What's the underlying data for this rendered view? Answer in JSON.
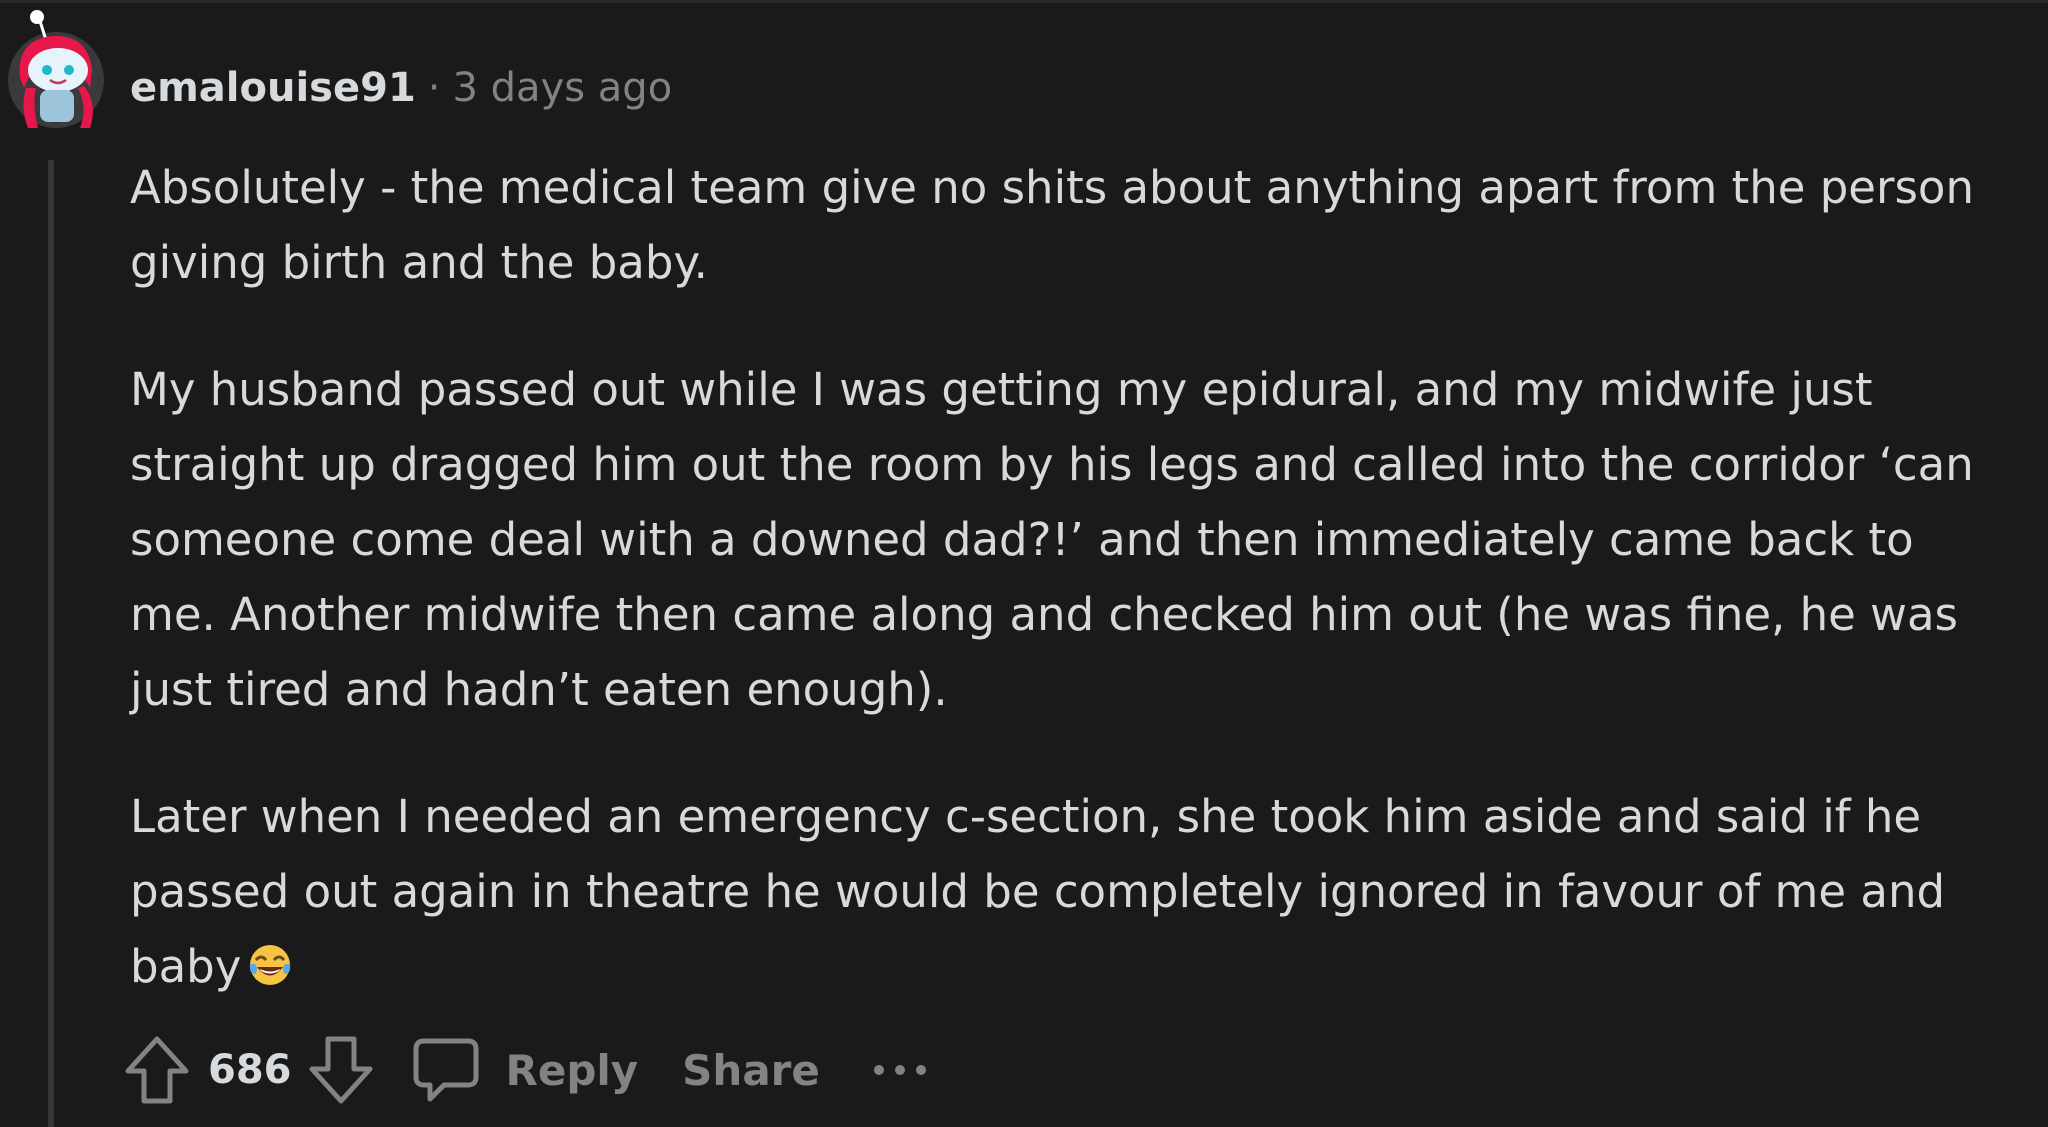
{
  "comment": {
    "username": "emalouise91",
    "separator": "·",
    "timestamp": "3 days ago",
    "paragraphs": [
      "Absolutely - the medical team give no shits about anything apart from the person giving birth and the baby.",
      "My husband passed out while I was getting my epidural, and my midwife just straight up dragged him out the room by his legs and called into the corridor ‘can someone come deal with a downed dad?!’ and then immediately came back to me. Another midwife then came along and checked him out (he was fine, he was just tired and hadn’t eaten enough).",
      "Later when I needed an emergency c-section, she took him aside and said if he passed out again in theatre he would be completely ignored in favour of me and baby"
    ],
    "emoji": "tears-of-joy-emoji"
  },
  "actions": {
    "score": "686",
    "reply_label": "Reply",
    "share_label": "Share"
  },
  "icons": {
    "avatar": "snoo-avatar",
    "upvote": "upvote-arrow-icon",
    "downvote": "downvote-arrow-icon",
    "reply": "speech-bubble-icon",
    "more": "more-options-icon"
  },
  "colors": {
    "background": "#1a1a1b",
    "text": "#d7dadc",
    "muted": "#818384",
    "thread_line": "#343536",
    "avatar_hair": "#e8174b",
    "avatar_face": "#e6f3fa"
  }
}
